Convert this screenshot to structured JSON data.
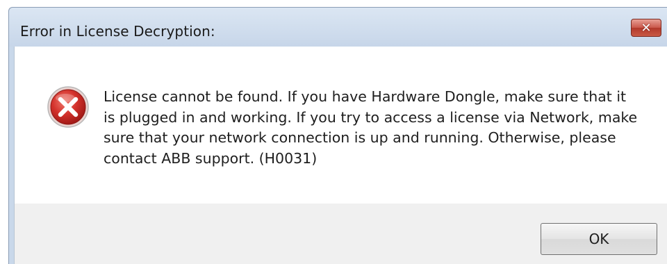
{
  "window": {
    "title": "Error in License Decryption:",
    "close_label": "✕"
  },
  "dialog": {
    "icon": "error-icon",
    "message": "License cannot be found. If you have Hardware Dongle, make sure that it is plugged in and working. If you try to access a license via Network, make sure that your network connection is up and running. Otherwise, please contact ABB support. (H0031)"
  },
  "buttons": {
    "ok_label": "OK"
  },
  "colors": {
    "titlebar": "#c9d8ea",
    "close_button": "#c9574a",
    "error_icon": "#d3312b",
    "footer": "#f0f0f0"
  }
}
